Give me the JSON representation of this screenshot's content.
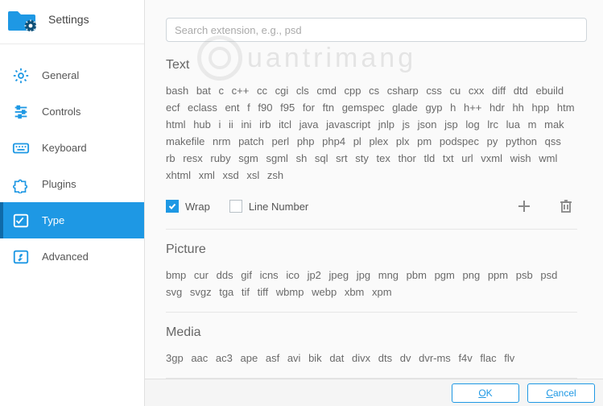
{
  "header": {
    "title": "Settings"
  },
  "sidebar": {
    "items": [
      {
        "id": "general",
        "label": "General"
      },
      {
        "id": "controls",
        "label": "Controls"
      },
      {
        "id": "keyboard",
        "label": "Keyboard"
      },
      {
        "id": "plugins",
        "label": "Plugins"
      },
      {
        "id": "type",
        "label": "Type"
      },
      {
        "id": "advanced",
        "label": "Advanced"
      }
    ],
    "active": "type"
  },
  "search": {
    "placeholder": "Search extension, e.g., psd"
  },
  "watermark": {
    "text": "uantrimang"
  },
  "sections": [
    {
      "title": "Text",
      "exts": [
        "bash",
        "bat",
        "c",
        "c++",
        "cc",
        "cgi",
        "cls",
        "cmd",
        "cpp",
        "cs",
        "csharp",
        "css",
        "cu",
        "cxx",
        "diff",
        "dtd",
        "ebuild",
        "ecf",
        "eclass",
        "ent",
        "f",
        "f90",
        "f95",
        "for",
        "ftn",
        "gemspec",
        "glade",
        "gyp",
        "h",
        "h++",
        "hdr",
        "hh",
        "hpp",
        "htm",
        "html",
        "hub",
        "i",
        "ii",
        "ini",
        "irb",
        "itcl",
        "java",
        "javascript",
        "jnlp",
        "js",
        "json",
        "jsp",
        "log",
        "lrc",
        "lua",
        "m",
        "mak",
        "makefile",
        "nrm",
        "patch",
        "perl",
        "php",
        "php4",
        "pl",
        "plex",
        "plx",
        "pm",
        "podspec",
        "py",
        "python",
        "qss",
        "rb",
        "resx",
        "ruby",
        "sgm",
        "sgml",
        "sh",
        "sql",
        "srt",
        "sty",
        "tex",
        "thor",
        "tld",
        "txt",
        "url",
        "vxml",
        "wish",
        "wml",
        "xhtml",
        "xml",
        "xsd",
        "xsl",
        "zsh"
      ],
      "options": {
        "wrap": {
          "label": "Wrap",
          "checked": true
        },
        "line_number": {
          "label": "Line Number",
          "checked": false
        }
      }
    },
    {
      "title": "Picture",
      "exts": [
        "bmp",
        "cur",
        "dds",
        "gif",
        "icns",
        "ico",
        "jp2",
        "jpeg",
        "jpg",
        "mng",
        "pbm",
        "pgm",
        "png",
        "ppm",
        "psb",
        "psd",
        "svg",
        "svgz",
        "tga",
        "tif",
        "tiff",
        "wbmp",
        "webp",
        "xbm",
        "xpm"
      ]
    },
    {
      "title": "Media",
      "exts": [
        "3gp",
        "aac",
        "ac3",
        "ape",
        "asf",
        "avi",
        "bik",
        "dat",
        "divx",
        "dts",
        "dv",
        "dvr-ms",
        "f4v",
        "flac",
        "flv"
      ]
    }
  ],
  "buttons": {
    "ok": "OK",
    "cancel": "Cancel"
  }
}
